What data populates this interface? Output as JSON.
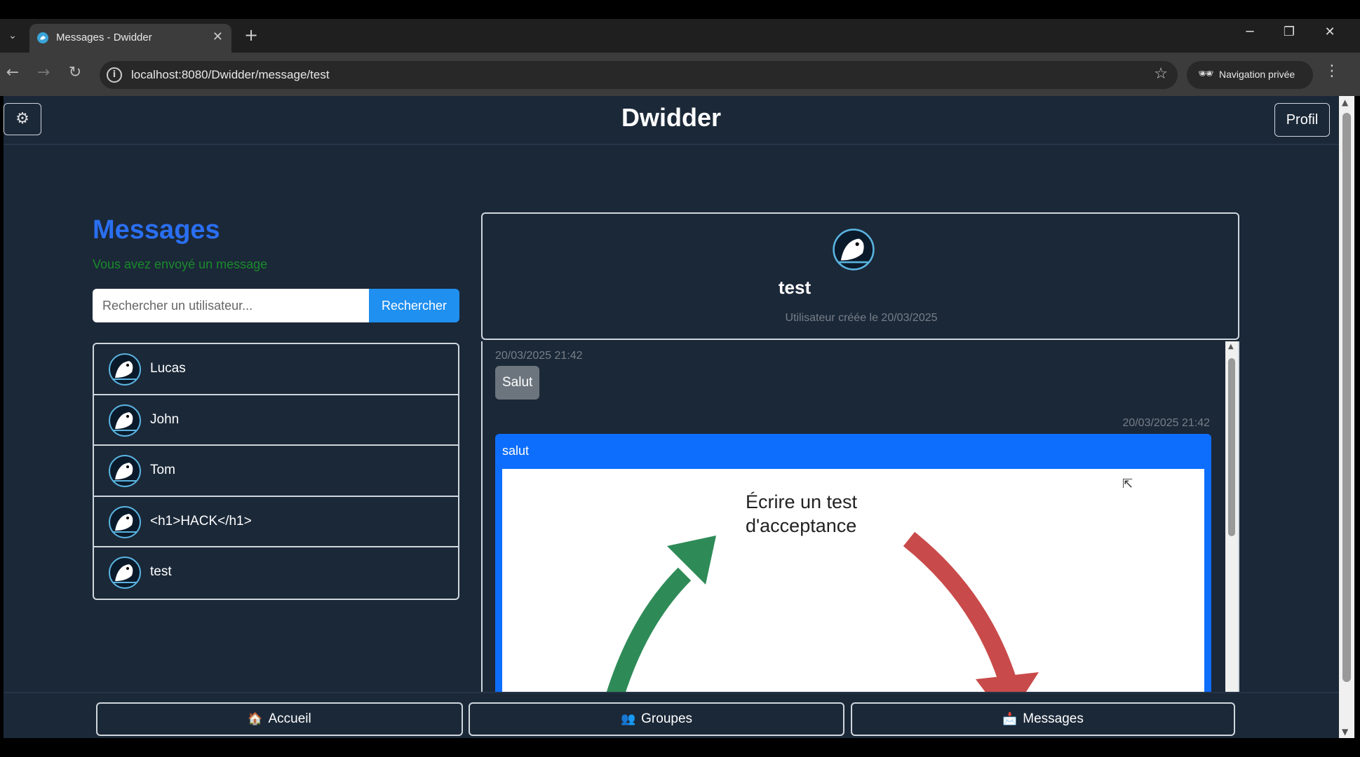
{
  "browser": {
    "tab_title": "Messages - Dwidder",
    "url": "localhost:8080/Dwidder/message/test",
    "private_label": "Navigation privée"
  },
  "header": {
    "brand": "Dwidder",
    "profile_button": "Profil"
  },
  "sidebar": {
    "heading": "Messages",
    "flash": "Vous avez envoyé un message",
    "search_placeholder": "Rechercher un utilisateur...",
    "search_button": "Rechercher",
    "users": [
      {
        "name": "Lucas"
      },
      {
        "name": "John"
      },
      {
        "name": "Tom"
      },
      {
        "name": "<h1>HACK</h1>"
      },
      {
        "name": "test"
      }
    ]
  },
  "conversation": {
    "username": "test",
    "created": "Utilisateur créée le 20/03/2025",
    "messages": [
      {
        "time": "20/03/2025 21:42",
        "text": "Salut",
        "direction": "received"
      },
      {
        "time": "20/03/2025 21:42",
        "text": "salut",
        "direction": "sent",
        "image_caption_line1": "Écrire un test",
        "image_caption_line2": "d'acceptance"
      }
    ]
  },
  "bottom_nav": {
    "home": "Accueil",
    "groups": "Groupes",
    "messages": "Messages"
  },
  "colors": {
    "page_bg": "#1b2838",
    "accent_blue": "#0d6efd",
    "heading_blue": "#2a6ff2",
    "success_green": "#1a8a2b",
    "arrow_green": "#2e8b57",
    "arrow_red": "#c94a4a"
  }
}
